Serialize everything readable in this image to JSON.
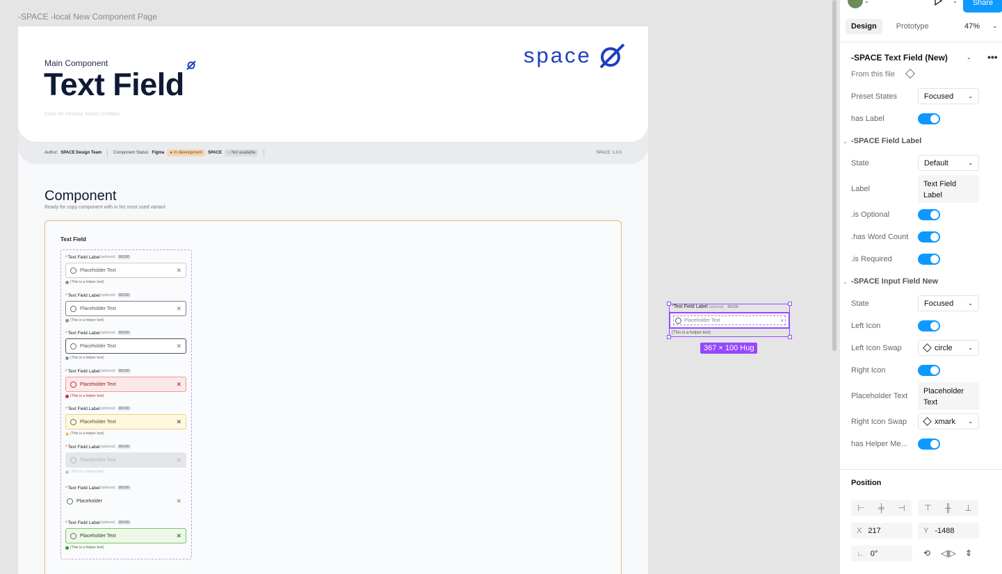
{
  "canvas": {
    "frame_title": "-SPACE -local New Component Page",
    "hero": {
      "eyebrow": "Main Component",
      "title": "Text Field",
      "scale_note": "Scale for Desktop Screen (1440px)",
      "logo_text": "space"
    },
    "meta": {
      "author_label": "Author:",
      "author": "SPACE Design Team",
      "status_label": "Component Status:",
      "figma": "Figma",
      "figma_status": "In development",
      "space": "SPACE",
      "space_status": "Not available",
      "version": "SPACE: 1.0.0"
    },
    "section": {
      "title": "Component",
      "subtitle": "Ready for copy component with in his most used variant"
    },
    "showcase": {
      "label": "Text Field",
      "variants": [
        {
          "label": "Text Field Label",
          "optional": "(optional)",
          "count": "00/100",
          "placeholder": "Placeholder Text",
          "helper": "(This is a helper text)",
          "state": "default"
        },
        {
          "label": "Text Field Label",
          "optional": "(optional)",
          "count": "00/100",
          "placeholder": "Placeholder Text",
          "helper": "(This is a helper text)",
          "state": "focus"
        },
        {
          "label": "Text Field Label",
          "optional": "(optional)",
          "count": "00/100",
          "placeholder": "Placeholder Text",
          "helper": "(This is a helper text)",
          "state": "active"
        },
        {
          "label": "Text Field Label",
          "optional": "(optional)",
          "count": "00/100",
          "placeholder": "Placeholder Text",
          "helper": "(This is a helper text)",
          "state": "error"
        },
        {
          "label": "Text Field Label",
          "optional": "(optional)",
          "count": "00/100",
          "placeholder": "Placeholder Text",
          "helper": "(This is a helper text)",
          "state": "warning"
        },
        {
          "label": "Text Field Label",
          "optional": "(optional)",
          "count": "00/100",
          "placeholder": "Placeholder Text",
          "helper": "(This is a helper text)",
          "state": "disabled"
        },
        {
          "label": "Text Field Label",
          "optional": "(optional)",
          "count": "00/100",
          "placeholder": "Placeholder",
          "helper": "",
          "state": "ghost"
        },
        {
          "label": "Text Field Label",
          "optional": "(optional)",
          "count": "00/100",
          "placeholder": "Placeholder Text",
          "helper": "(This is a helper text)",
          "state": "success"
        }
      ]
    },
    "selected_instance": {
      "label": "Text Field Label",
      "optional": "(optional)",
      "count": "00/100",
      "placeholder": "Placeholder Text",
      "helper": "(This is a helper text)",
      "size_badge": "367 × 100 Hug"
    }
  },
  "panel": {
    "share_label": "Share",
    "tabs": [
      "Design",
      "Prototype"
    ],
    "zoom": "47%",
    "component_name": "-SPACE Text Field (New)",
    "from_file": "From this file",
    "props": {
      "preset_states_label": "Preset States",
      "preset_states_value": "Focused",
      "has_label": "has Label",
      "field_label_section": "-SPACE Field Label",
      "state_label": "State",
      "state_value": "Default",
      "label_label": "Label",
      "label_value": "Text Field Label",
      "is_optional": ".is Optional",
      "has_word_count": ".has Word Count",
      "is_required": ".is Required",
      "input_section": "-SPACE Input Field New",
      "input_state_label": "State",
      "input_state_value": "Focused",
      "left_icon": "Left Icon",
      "left_icon_swap": "Left Icon Swap",
      "left_icon_swap_value": "circle",
      "right_icon": "Right Icon",
      "placeholder_label": "Placeholder Text",
      "placeholder_value": "Placeholder Text",
      "right_icon_swap": "Right Icon Swap",
      "right_icon_swap_value": "xmark",
      "has_helper": "has Helper Me..."
    },
    "position": {
      "title": "Position",
      "x_label": "X",
      "x": "217",
      "y_label": "Y",
      "y": "-1488",
      "rotation": "0°"
    },
    "toggles_on": true,
    "accent": "#0d99ff",
    "selection_color": "#9747ff"
  }
}
